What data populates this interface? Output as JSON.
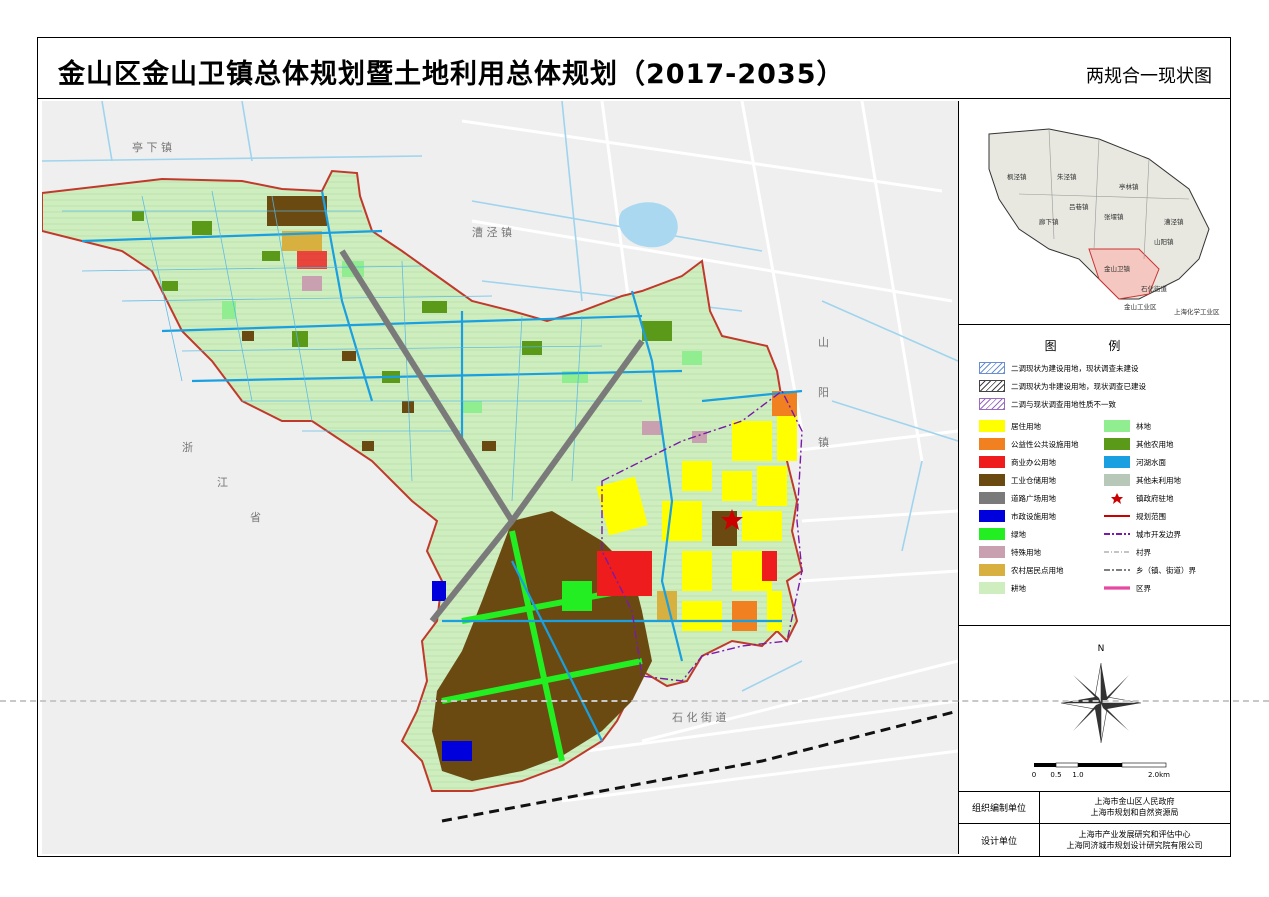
{
  "title": "金山区金山卫镇总体规划暨土地利用总体规划（2017-2035）",
  "subtitle": "两规合一现状图",
  "map": {
    "place_labels": {
      "tinglin": "亭 下 镇",
      "caojing": "漕 泾 镇",
      "shanyang_vertical": [
        "山",
        "阳",
        "镇"
      ],
      "zhejiang_vertical": [
        "浙",
        "江",
        "省"
      ],
      "shihua": "石 化 街 道"
    }
  },
  "inset": {
    "labels": [
      "枫泾镇",
      "朱泾镇",
      "亭林镇",
      "吕巷镇",
      "张堰镇",
      "漕泾镇",
      "廊下镇",
      "金山卫镇",
      "山阳镇",
      "石化街道",
      "金山工业区",
      "上海化学工业区"
    ]
  },
  "legend": {
    "title": "图 例",
    "hatch_items": [
      {
        "label": "二调现状为建设用地，现状调查未建设",
        "color": "#6a8fd0"
      },
      {
        "label": "二调现状为非建设用地，现状调查已建设",
        "color": "#444444"
      },
      {
        "label": "二调与现状调查用地性质不一致",
        "color": "#9a6ac0"
      }
    ],
    "left_items": [
      {
        "label": "居住用地",
        "color": "#ffff00"
      },
      {
        "label": "公益性公共设施用地",
        "color": "#f08020"
      },
      {
        "label": "商业办公用地",
        "color": "#ee1c1c"
      },
      {
        "label": "工业仓储用地",
        "color": "#6b4a12"
      },
      {
        "label": "道路广场用地",
        "color": "#7a7a7a"
      },
      {
        "label": "市政设施用地",
        "color": "#0000dd"
      },
      {
        "label": "绿地",
        "color": "#22ee22"
      },
      {
        "label": "特殊用地",
        "color": "#c8a0b0"
      },
      {
        "label": "农村居民点用地",
        "color": "#d8b040"
      },
      {
        "label": "耕地",
        "color": "#cfeec0"
      }
    ],
    "right_items": [
      {
        "label": "林地",
        "color": "#90ee90",
        "kind": "fill"
      },
      {
        "label": "其他农用地",
        "color": "#5a9a18",
        "kind": "fill"
      },
      {
        "label": "河湖水面",
        "color": "#1aa0e0",
        "kind": "fill"
      },
      {
        "label": "其他未利用地",
        "color": "#b8c8b8",
        "kind": "fill"
      },
      {
        "label": "镇政府驻地",
        "color": "#cc0000",
        "kind": "star"
      },
      {
        "label": "规划范围",
        "color": "#cc0000",
        "kind": "line"
      },
      {
        "label": "城市开发边界",
        "color": "#7a1aa8",
        "kind": "dashdot"
      },
      {
        "label": "村界",
        "color": "#888888",
        "kind": "dashdot-thin"
      },
      {
        "label": "乡（镇、街道）界",
        "color": "#555555",
        "kind": "dashdot-gray"
      },
      {
        "label": "区界",
        "color": "#e0208a",
        "kind": "boundary"
      }
    ]
  },
  "compass": {
    "north_label": "N",
    "scale_ticks": [
      "0",
      "0.5",
      "1.0",
      "2.0km"
    ]
  },
  "credits": {
    "org_head": "组织编制单位",
    "org_lines": [
      "上海市金山区人民政府",
      "上海市规划和自然资源局"
    ],
    "design_head": "设计单位",
    "design_lines": [
      "上海市产业发展研究和评估中心",
      "上海同济城市规划设计研究院有限公司"
    ]
  },
  "colors": {
    "farmland": "#cfeec0",
    "forest": "#90ee90",
    "industrial": "#6b4a12",
    "residential": "#ffff00",
    "water": "#1aa0e0",
    "boundary": "#c0392b",
    "district_boundary": "#e0208a"
  }
}
